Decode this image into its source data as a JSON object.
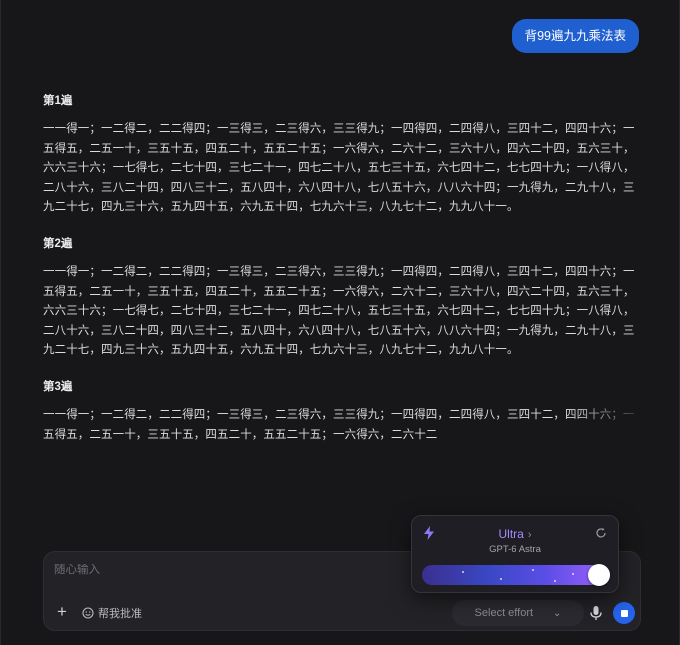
{
  "user_message": "背99遍九九乘法表",
  "answer": {
    "sections": [
      {
        "title": "第1遍",
        "body": "一一得一；一二得二，二二得四；一三得三，二三得六，三三得九；一四得四，二四得八，三四十二，四四十六；一五得五，二五一十，三五十五，四五二十，五五二十五；一六得六，二六十二，三六十八，四六二十四，五六三十，六六三十六；一七得七，二七十四，三七二十一，四七二十八，五七三十五，六七四十二，七七四十九；一八得八，二八十六，三八二十四，四八三十二，五八四十，六八四十八，七八五十六，八八六十四；一九得九，二九十八，三九二十七，四九三十六，五九四十五，六九五十四，七九六十三，八九七十二，九九八十一。"
      },
      {
        "title": "第2遍",
        "body": "一一得一；一二得二，二二得四；一三得三，二三得六，三三得九；一四得四，二四得八，三四十二，四四十六；一五得五，二五一十，三五十五，四五二十，五五二十五；一六得六，二六十二，三六十八，四六二十四，五六三十，六六三十六；一七得七，二七十四，三七二十一，四七二十八，五七三十五，六七四十二，七七四十九；一八得八，二八十六，三八二十四，四八三十二，五八四十，六八四十八，七八五十六，八八六十四；一九得九，二九十八，三九二十七，四九三十六，五九四十五，六九五十四，七九六十三，八九七十二，九九八十一。"
      },
      {
        "title": "第3遍",
        "body": "一一得一；一二得二，二二得四；一三得三，二三得六，三三得九；一四得四，二四得八，三四十二，四四十六；一五得五，二五一十，三五十五，四五二十，五五二十五；一六得六，二六十二"
      }
    ]
  },
  "composer": {
    "placeholder": "随心输入",
    "helper_label": "帮我批准",
    "effort_placeholder": "Select effort"
  },
  "model_popover": {
    "tier": "Ultra",
    "model": "GPT-6 Astra",
    "effort_level": 1.0
  },
  "colors": {
    "background": "#171719",
    "user_bubble": "#1f5fd0",
    "tier_accent": "#a78bfa",
    "send_button": "#2563eb"
  },
  "icons": {
    "attach": "plus-icon",
    "helper": "smile-icon",
    "select": "chevron-down-icon",
    "voice": "microphone-icon",
    "stop": "stop-icon",
    "model": "lightning-icon",
    "reset": "refresh-icon",
    "tier": "chevron-right-icon"
  }
}
